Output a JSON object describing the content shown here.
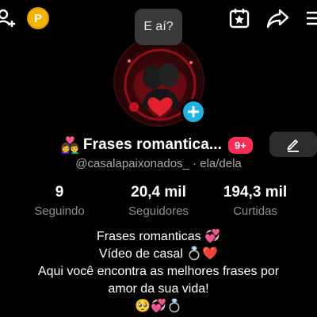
{
  "header": {
    "coin_label": "P",
    "bubble_text": "E aí?",
    "icons": [
      "add-friend-icon",
      "coin-icon",
      "calendar-star-icon",
      "share-icon",
      "menu-icon"
    ]
  },
  "profile": {
    "name_emoji": "👩‍❤️‍👨",
    "display_name": "Frases romantica...",
    "notification_badge": "9+",
    "handle": "@casalapaixonados_ · ela/dela"
  },
  "stats": [
    {
      "value": "9",
      "label": "Seguindo"
    },
    {
      "value": "20,4 mil",
      "label": "Seguidores"
    },
    {
      "value": "194,3 mil",
      "label": "Curtidas"
    }
  ],
  "bio": {
    "line1": "Frases romanticas 💞",
    "line2": "Vídeo de casal 💍❤️",
    "line3": "Aqui você encontra as melhores frases por",
    "line4": "amor da sua vida!",
    "line5": "🥺💞💍"
  },
  "colors": {
    "background": "#000000",
    "accent_red": "#fe2c55",
    "follow_blue": "#20b4e6",
    "coin_gold": "#f4b400"
  }
}
